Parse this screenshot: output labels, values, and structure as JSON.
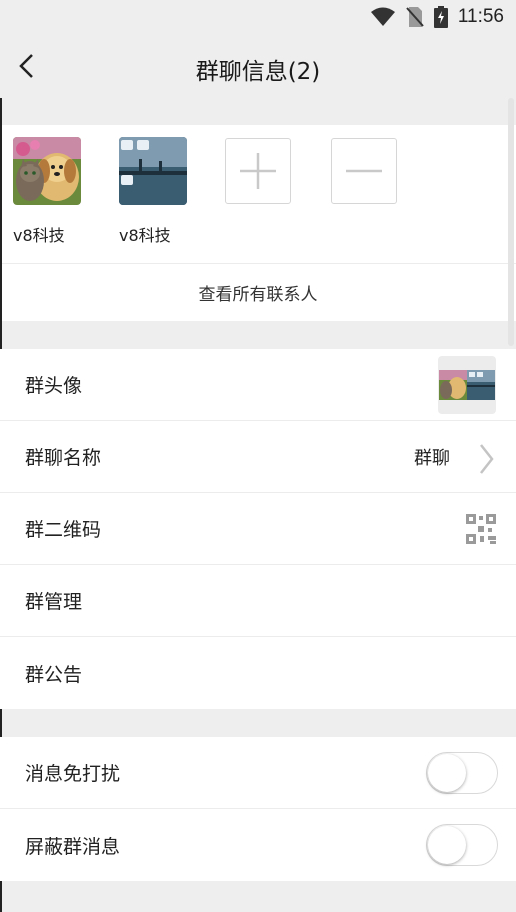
{
  "status_bar": {
    "time": "11:56"
  },
  "header": {
    "title": "群聊信息(2)"
  },
  "members": [
    {
      "name": "v8科技",
      "avatar": "puppy-kitten-photo"
    },
    {
      "name": "v8科技",
      "avatar": "pier-photo"
    }
  ],
  "member_actions": {
    "add": "plus-icon",
    "remove": "minus-icon"
  },
  "view_all_label": "查看所有联系人",
  "info_rows": {
    "avatar_label": "群头像",
    "name_label": "群聊名称",
    "name_value": "群聊",
    "qrcode_label": "群二维码",
    "manage_label": "群管理",
    "notice_label": "群公告"
  },
  "toggles": {
    "mute_label": "消息免打扰",
    "mute_on": false,
    "block_label": "屏蔽群消息",
    "block_on": false
  }
}
